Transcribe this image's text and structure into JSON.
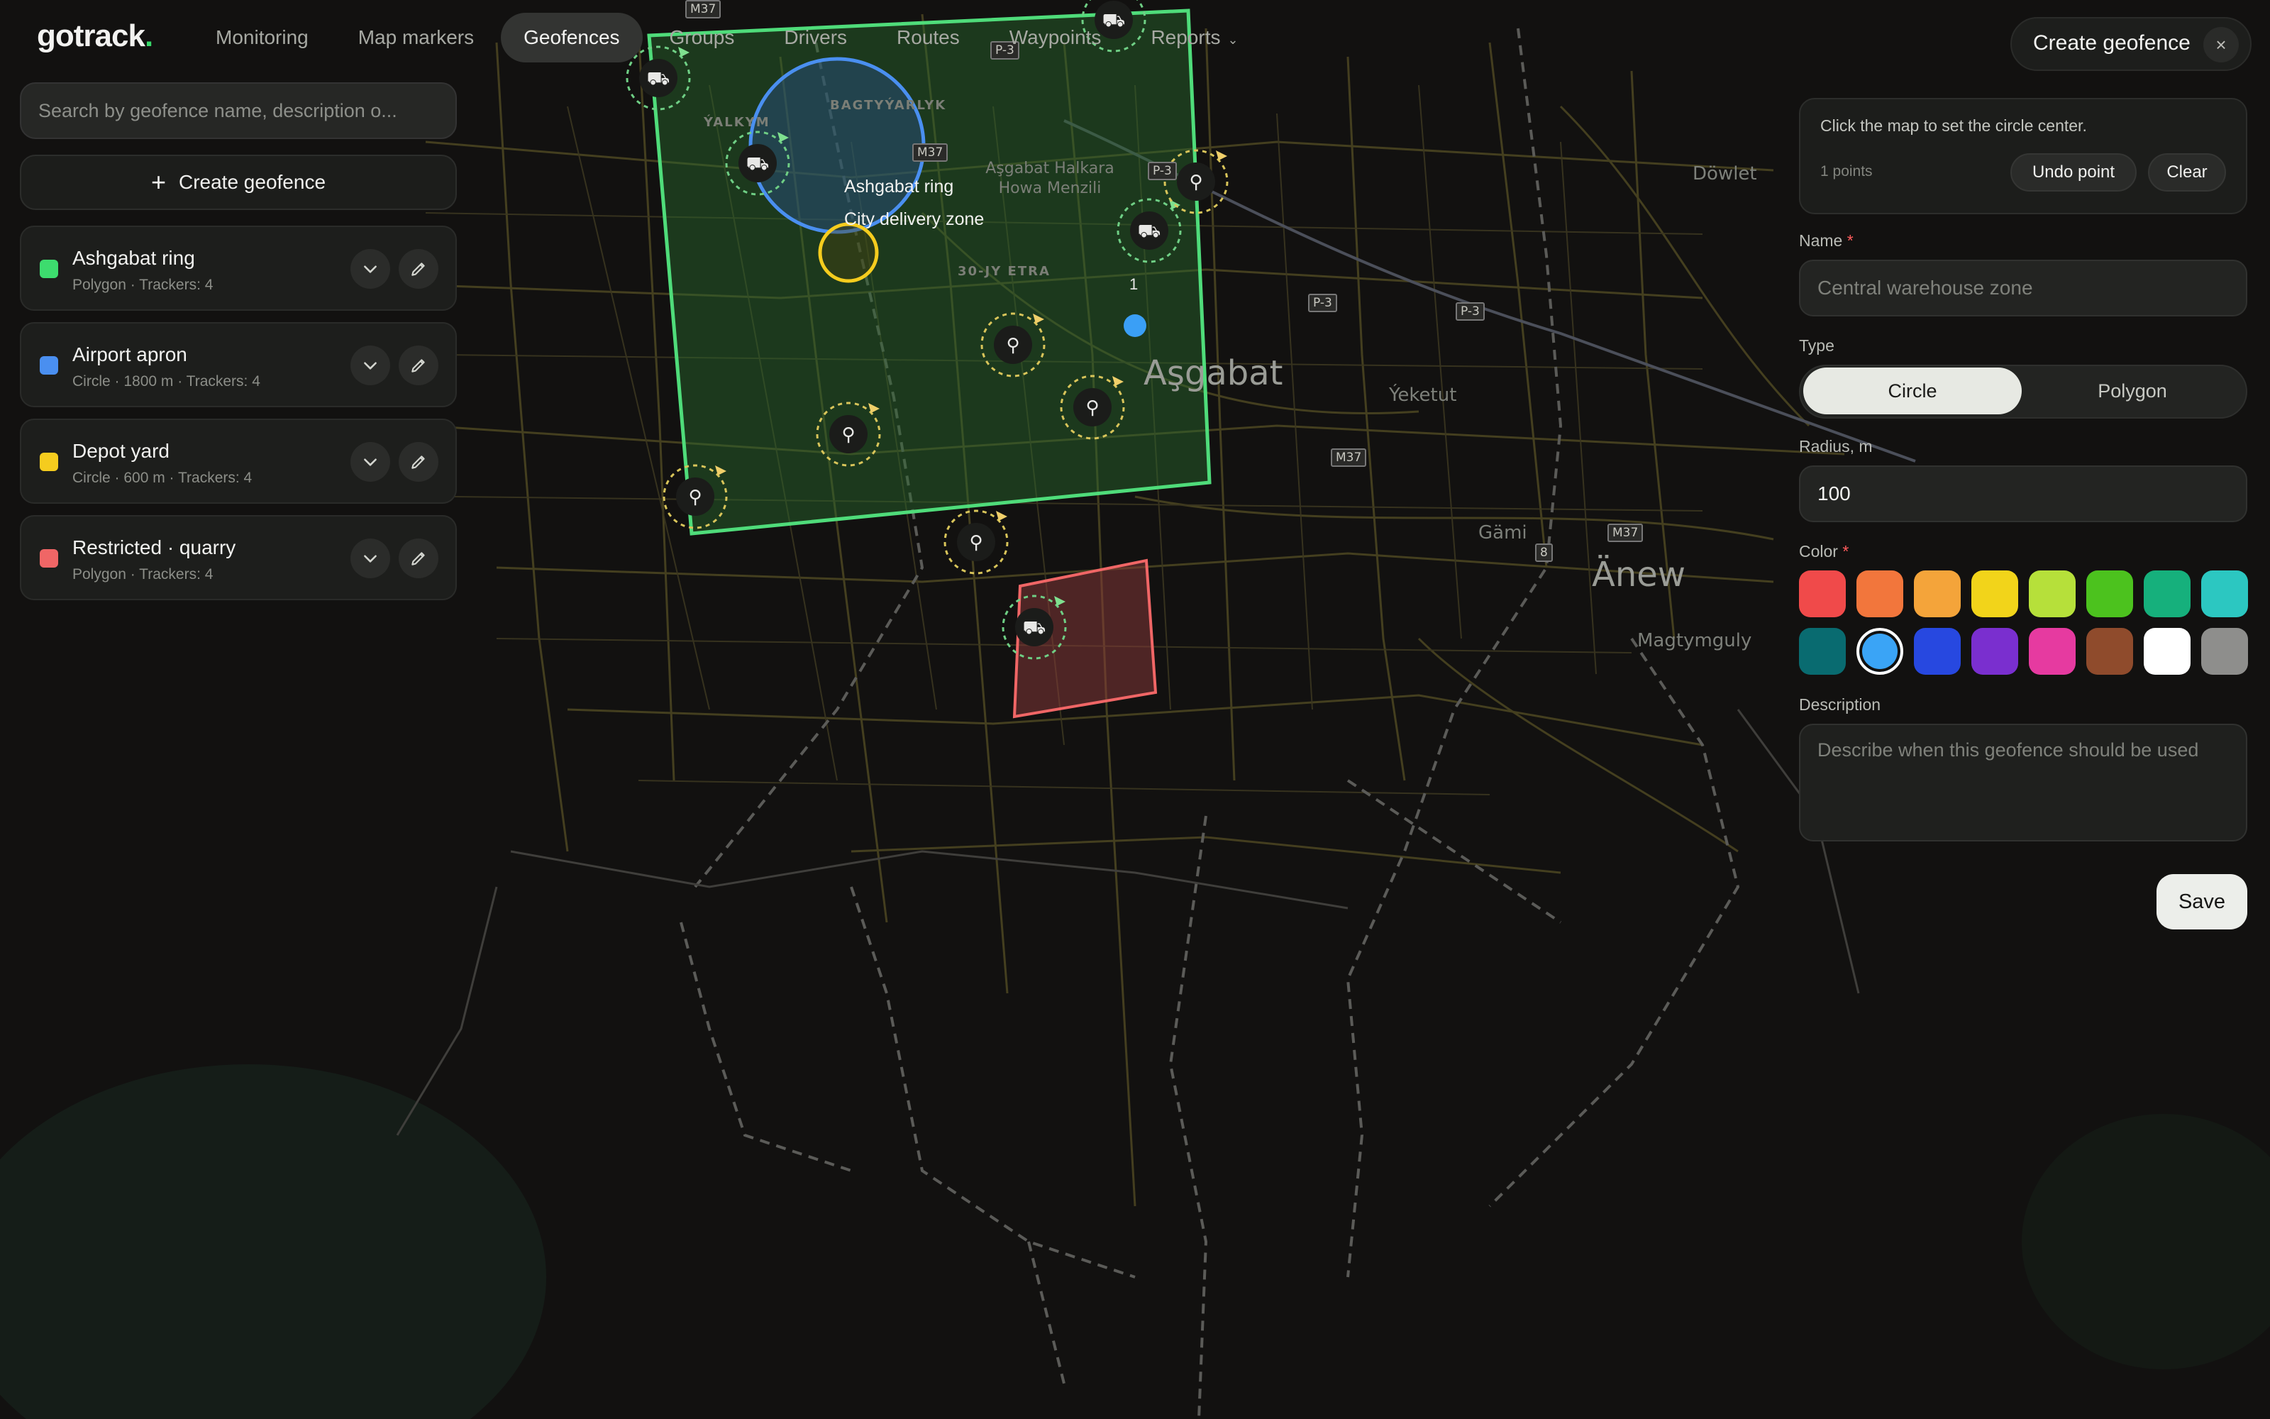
{
  "header": {
    "logo": "gotrack",
    "nav": [
      {
        "label": "Monitoring"
      },
      {
        "label": "Map markers"
      },
      {
        "label": "Geofences"
      },
      {
        "label": "Groups"
      },
      {
        "label": "Drivers"
      },
      {
        "label": "Routes"
      },
      {
        "label": "Waypoints"
      },
      {
        "label": "Reports"
      }
    ],
    "active_nav": "Geofences"
  },
  "sidebar": {
    "search_placeholder": "Search by geofence name, description o...",
    "create_label": "Create geofence",
    "geofences": [
      {
        "name": "Ashgabat ring",
        "meta": "Polygon · Trackers: 4",
        "color": "#3ddc6e"
      },
      {
        "name": "Airport apron",
        "meta": "Circle · 1800 m · Trackers: 4",
        "color": "#4a8ff0"
      },
      {
        "name": "Depot yard",
        "meta": "Circle · 600 m · Trackers: 4",
        "color": "#f5cc1e"
      },
      {
        "name": "Restricted · quarry",
        "meta": "Polygon · Trackers: 4",
        "color": "#f06666"
      }
    ]
  },
  "map": {
    "tooltip": {
      "title": "Ashgabat ring",
      "subtitle": "City delivery zone"
    },
    "point_label": "1",
    "labels": {
      "asgabat": "Aşgabat",
      "anew": "Änew",
      "yeketut": "Ýeketut",
      "gami": "Gämi",
      "dowlet": "Döwlet",
      "magtymguly": "Magtymguly",
      "bagtyyarlyk": "BAGTYÝARLYK",
      "yalkym": "ÝALKYM",
      "ainy": "30-JY ETRA",
      "airport": "Aşgabat Halkara Howa Menzili"
    },
    "shields": [
      "M37",
      "P-3",
      "P-3",
      "P-3",
      "M37",
      "M37",
      "M37",
      "P-3",
      "8"
    ]
  },
  "form": {
    "title": "Create geofence",
    "close": "×",
    "hint": "Click the map to set the circle center.",
    "points": "1 points",
    "undo_label": "Undo point",
    "clear_label": "Clear",
    "name_label": "Name",
    "name_placeholder": "Central warehouse zone",
    "required_mark": "*",
    "type_label": "Type",
    "type_options": [
      "Circle",
      "Polygon"
    ],
    "type_selected": "Circle",
    "radius_label": "Radius, m",
    "radius_value": "100",
    "color_label": "Color",
    "colors": [
      "#f04a4a",
      "#f2763c",
      "#f4a43a",
      "#f2d41a",
      "#b6e03a",
      "#4cc21e",
      "#16b07c",
      "#2cc7c1",
      "#096b70",
      "#3aa4f6",
      "#2748e0",
      "#7a2fcf",
      "#e63aa0",
      "#8f4b2c",
      "#ffffff",
      "#8e8e8c"
    ],
    "selected_color": "#3aa4f6",
    "description_label": "Description",
    "description_placeholder": "Describe when this geofence should be used",
    "save_label": "Save"
  }
}
